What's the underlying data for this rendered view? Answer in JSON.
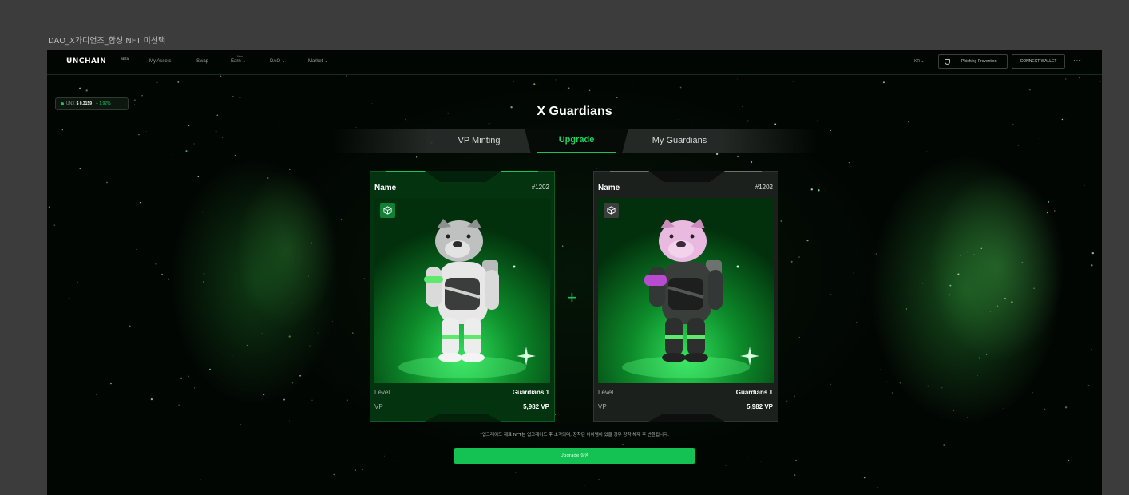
{
  "frame_title": "DAO_X가디언즈_합성 NFT 미선택",
  "nav": {
    "logo": "UNCHAIN",
    "logo_badge": "BETA",
    "new_tag": "New",
    "items": [
      {
        "label": "My Assets",
        "chevron": false
      },
      {
        "label": "Swap",
        "chevron": false
      },
      {
        "label": "Earn",
        "chevron": true
      },
      {
        "label": "DAO",
        "chevron": true
      },
      {
        "label": "Market",
        "chevron": true
      }
    ],
    "language": "KR",
    "phishing": "Phishing Prevention",
    "wallet": "CONNECT WALLET",
    "more": "···"
  },
  "price": {
    "symbol": "UNX",
    "value": "$ 0.3159",
    "change": "+ 1.92%"
  },
  "title": "X Guardians",
  "tabs": [
    {
      "label": "VP Minting",
      "active": false
    },
    {
      "label": "Upgrade",
      "active": true
    },
    {
      "label": "My Guardians",
      "active": false
    }
  ],
  "cards": [
    {
      "name": "Name",
      "id": "#1202",
      "level_label": "Level",
      "level": "Guardians 1",
      "vp_label": "VP",
      "vp": "5,982 VP",
      "variant": "white",
      "icon": "box-icon"
    },
    {
      "name": "Name",
      "id": "#1202",
      "level_label": "Level",
      "level": "Guardians 1",
      "vp_label": "VP",
      "vp": "5,982 VP",
      "variant": "pink",
      "icon": "box-icon"
    }
  ],
  "plus": "+",
  "notice": "*업그레이드 재료 NFT는 업그레이드 후 소각되며, 장착된 아이템이 있을 경우 장착 해제 후 반환됩니다.",
  "upgrade_button": "Upgrade 실행",
  "colors": {
    "accent": "#1fc05a",
    "background": "#020603",
    "button": "#13c253"
  }
}
